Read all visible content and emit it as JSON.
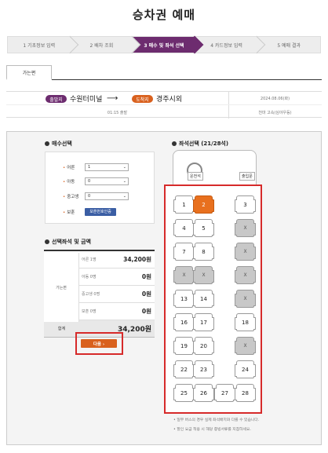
{
  "page": {
    "title": "승차권 예매"
  },
  "steps": [
    {
      "label": "1 기초정보 입력",
      "active": false
    },
    {
      "label": "2 배차 조회",
      "active": false
    },
    {
      "label": "3 매수 및 좌석 선택",
      "active": true
    },
    {
      "label": "4 카드정보 입력",
      "active": false
    },
    {
      "label": "5 예매 결과",
      "active": false
    }
  ],
  "tab": {
    "label": "가는편"
  },
  "route": {
    "departure_badge": "출발지",
    "departure": "수원터미널",
    "arrival_badge": "도착지",
    "arrival": "경주시외",
    "arrow": "⟶",
    "date": "2024.08.06(화)",
    "departure_time": "01:15 출발",
    "company": "천마 고속(심야우등)"
  },
  "count_section": {
    "title": "매수선택",
    "rows": [
      {
        "label": "어른",
        "value": "1"
      },
      {
        "label": "아동",
        "value": "0"
      },
      {
        "label": "중고생",
        "value": "0"
      }
    ],
    "veteran_label": "보훈",
    "veteran_button": "보훈번호인증"
  },
  "fare_section": {
    "title": "선택좌석 및 금액",
    "category": "가는편",
    "rows": [
      {
        "name": "어른 1명",
        "amount": "34,200원"
      },
      {
        "name": "아동 0명",
        "amount": "0원"
      },
      {
        "name": "중고생 0명",
        "amount": "0원"
      },
      {
        "name": "보훈 0명",
        "amount": "0원"
      }
    ],
    "total_label": "합계",
    "total_amount": "34,200원"
  },
  "next_button": {
    "label": "다음 ›"
  },
  "seat_section": {
    "title": "좌석선택 (21/28석)",
    "driver_label": "운전석",
    "door_label": "출입문",
    "seats": [
      {
        "num": "1",
        "state": "available"
      },
      {
        "num": "2",
        "state": "selected"
      },
      {
        "num": "3",
        "state": "available"
      },
      {
        "num": "4",
        "state": "available"
      },
      {
        "num": "5",
        "state": "available"
      },
      {
        "num": "6",
        "state": "taken"
      },
      {
        "num": "7",
        "state": "available"
      },
      {
        "num": "8",
        "state": "available"
      },
      {
        "num": "9",
        "state": "taken"
      },
      {
        "num": "10",
        "state": "taken"
      },
      {
        "num": "11",
        "state": "taken"
      },
      {
        "num": "12",
        "state": "taken"
      },
      {
        "num": "13",
        "state": "available"
      },
      {
        "num": "14",
        "state": "available"
      },
      {
        "num": "15",
        "state": "taken"
      },
      {
        "num": "16",
        "state": "available"
      },
      {
        "num": "17",
        "state": "available"
      },
      {
        "num": "18",
        "state": "available"
      },
      {
        "num": "19",
        "state": "available"
      },
      {
        "num": "20",
        "state": "available"
      },
      {
        "num": "21",
        "state": "taken"
      },
      {
        "num": "22",
        "state": "available"
      },
      {
        "num": "23",
        "state": "available"
      },
      {
        "num": "24",
        "state": "available"
      },
      {
        "num": "25",
        "state": "available"
      },
      {
        "num": "26",
        "state": "available"
      },
      {
        "num": "27",
        "state": "available"
      },
      {
        "num": "28",
        "state": "available"
      }
    ],
    "taken_mark": "X"
  },
  "notices": [
    "• 일부 버스의 경우 실제 좌석배치와 다를 수 있습니다.",
    "• 할인 요금 적용 시 해당 증빙서류를 지참하세요."
  ],
  "colors": {
    "active_step": "#6d2c6f",
    "accent_orange": "#d9611e",
    "highlight_red": "#d62a2a",
    "discount_blue": "#3b5ea4"
  }
}
